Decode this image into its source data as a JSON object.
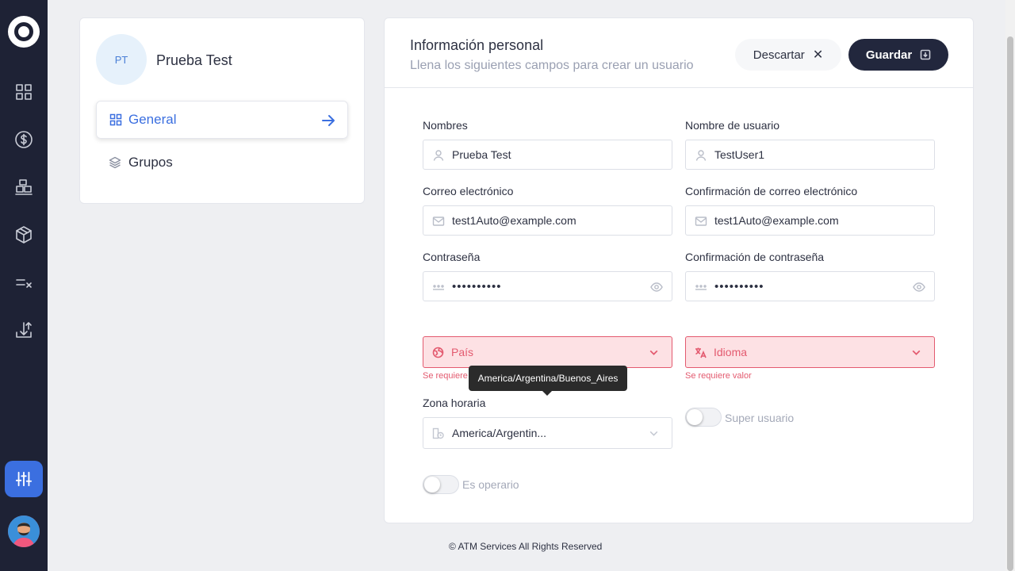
{
  "sidebar": {
    "icons": [
      "dashboard-icon",
      "dollar-icon",
      "boxes-icon",
      "cube-icon",
      "checklist-icon",
      "upload-icon",
      "settings-sliders-icon"
    ]
  },
  "profile": {
    "initials": "PT",
    "name": "Prueba Test",
    "menu": [
      {
        "label": "General",
        "icon": "grid-icon",
        "active": true
      },
      {
        "label": "Grupos",
        "icon": "layers-icon",
        "active": false
      }
    ]
  },
  "form": {
    "title": "Información personal",
    "subtitle": "Llena los siguientes campos para crear un usuario",
    "discard_label": "Descartar",
    "save_label": "Guardar",
    "nombres_label": "Nombres",
    "nombres_value": "Prueba Test",
    "usuario_label": "Nombre de usuario",
    "usuario_value": "TestUser1",
    "correo_label": "Correo electrónico",
    "correo_value": "test1Auto@example.com",
    "correo_conf_label": "Confirmación de correo electrónico",
    "correo_conf_value": "test1Auto@example.com",
    "pass_label": "Contraseña",
    "pass_value": "••••••••••",
    "pass_conf_label": "Confirmación de contraseña",
    "pass_conf_value": "••••••••••",
    "pais_placeholder": "País",
    "idioma_placeholder": "Idioma",
    "error_required": "Se requiere valor",
    "tooltip": "America/Argentina/Buenos_Aires",
    "zona_label": "Zona horaria",
    "zona_value": "America/Argentin...",
    "super_label": "Super usuario",
    "operario_label": "Es operario"
  },
  "footer": "© ATM Services All Rights Reserved",
  "colors": {
    "sidebar_bg": "#1e2235",
    "accent": "#3b6fe0",
    "save_bg": "#22273d",
    "error": "#e35a6f",
    "error_bg": "#fde1e4"
  }
}
